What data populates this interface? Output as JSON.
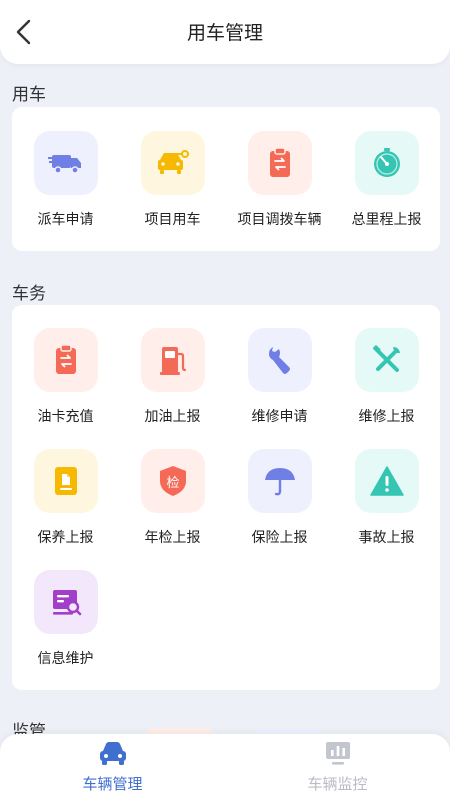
{
  "header": {
    "title": "用车管理"
  },
  "sections": {
    "use_car": {
      "title": "用车",
      "items": [
        {
          "label": "派车申请",
          "icon": "truck-icon",
          "tile_bg": "#eef0fd",
          "icon_color": "#6f7fe6"
        },
        {
          "label": "项目用车",
          "icon": "car-key-icon",
          "tile_bg": "#fff6df",
          "icon_color": "#f6b800"
        },
        {
          "label": "项目调拨车辆",
          "icon": "clipboard-transfer-icon",
          "tile_bg": "#ffeeea",
          "icon_color": "#f46a57"
        },
        {
          "label": "总里程上报",
          "icon": "odometer-icon",
          "tile_bg": "#e5f9f6",
          "icon_color": "#34c6b3"
        }
      ]
    },
    "car_affairs": {
      "title": "车务",
      "items": [
        {
          "label": "油卡充值",
          "icon": "clipboard-transfer-icon",
          "tile_bg": "#ffeeea",
          "icon_color": "#f46a57"
        },
        {
          "label": "加油上报",
          "icon": "fuel-pump-icon",
          "tile_bg": "#ffeeea",
          "icon_color": "#f46a57"
        },
        {
          "label": "维修申请",
          "icon": "wrench-icon",
          "tile_bg": "#eef0fd",
          "icon_color": "#6f7fe6"
        },
        {
          "label": "维修上报",
          "icon": "tools-icon",
          "tile_bg": "#e5f9f6",
          "icon_color": "#34c6b3"
        },
        {
          "label": "保养上报",
          "icon": "document-icon",
          "tile_bg": "#fff6df",
          "icon_color": "#f6b800"
        },
        {
          "label": "年检上报",
          "icon": "inspection-badge-icon",
          "tile_bg": "#ffeeea",
          "icon_color": "#f46a57",
          "badge_text": "检"
        },
        {
          "label": "保险上报",
          "icon": "umbrella-icon",
          "tile_bg": "#eef0fd",
          "icon_color": "#6f7fe6"
        },
        {
          "label": "事故上报",
          "icon": "warning-icon",
          "tile_bg": "#e5f9f6",
          "icon_color": "#34c6b3"
        },
        {
          "label": "信息维护",
          "icon": "info-maintenance-icon",
          "tile_bg": "#f3e8fb",
          "icon_color": "#a23fc9"
        }
      ]
    },
    "supervision": {
      "title": "监管"
    }
  },
  "tabbar": {
    "active_color": "#3f6fcf",
    "inactive_color": "#b9bcc6",
    "tabs": [
      {
        "label": "车辆管理",
        "icon": "car-icon",
        "active": true
      },
      {
        "label": "车辆监控",
        "icon": "monitor-chart-icon",
        "active": false
      }
    ]
  }
}
